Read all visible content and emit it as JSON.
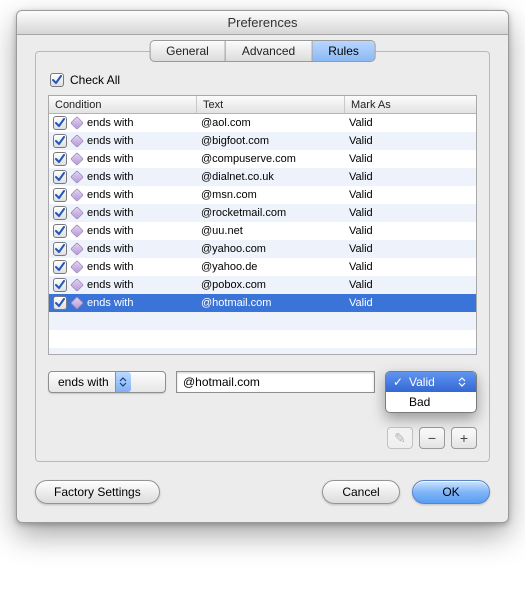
{
  "window": {
    "title": "Preferences"
  },
  "tabs": {
    "items": [
      {
        "label": "General",
        "selected": false
      },
      {
        "label": "Advanced",
        "selected": false
      },
      {
        "label": "Rules",
        "selected": true
      }
    ]
  },
  "check_all": {
    "label": "Check All",
    "checked": true
  },
  "table": {
    "columns": {
      "condition": "Condition",
      "text": "Text",
      "mark": "Mark As"
    },
    "rows": [
      {
        "checked": true,
        "condition": "ends with",
        "text": "@aol.com",
        "mark": "Valid",
        "selected": false
      },
      {
        "checked": true,
        "condition": "ends with",
        "text": "@bigfoot.com",
        "mark": "Valid",
        "selected": false
      },
      {
        "checked": true,
        "condition": "ends with",
        "text": "@compuserve.com",
        "mark": "Valid",
        "selected": false
      },
      {
        "checked": true,
        "condition": "ends with",
        "text": "@dialnet.co.uk",
        "mark": "Valid",
        "selected": false
      },
      {
        "checked": true,
        "condition": "ends with",
        "text": "@msn.com",
        "mark": "Valid",
        "selected": false
      },
      {
        "checked": true,
        "condition": "ends with",
        "text": "@rocketmail.com",
        "mark": "Valid",
        "selected": false
      },
      {
        "checked": true,
        "condition": "ends with",
        "text": "@uu.net",
        "mark": "Valid",
        "selected": false
      },
      {
        "checked": true,
        "condition": "ends with",
        "text": "@yahoo.com",
        "mark": "Valid",
        "selected": false
      },
      {
        "checked": true,
        "condition": "ends with",
        "text": "@yahoo.de",
        "mark": "Valid",
        "selected": false
      },
      {
        "checked": true,
        "condition": "ends with",
        "text": "@pobox.com",
        "mark": "Valid",
        "selected": false
      },
      {
        "checked": true,
        "condition": "ends with",
        "text": "@hotmail.com",
        "mark": "Valid",
        "selected": true
      }
    ]
  },
  "editor": {
    "condition_value": "ends with",
    "text_value": "@hotmail.com",
    "mark_menu": {
      "options": [
        {
          "label": "Valid",
          "checked": true,
          "highlighted": true
        },
        {
          "label": "Bad",
          "checked": false,
          "highlighted": false
        }
      ]
    }
  },
  "icon_buttons": {
    "edit": "✎",
    "remove": "−",
    "add": "+"
  },
  "footer": {
    "factory": "Factory Settings",
    "cancel": "Cancel",
    "ok": "OK"
  },
  "colors": {
    "selection": "#3a74d8",
    "alt_row": "#eef3fb",
    "aqua_blue_top": "#bcd9fe",
    "aqua_blue_bottom": "#7fb1f2"
  }
}
